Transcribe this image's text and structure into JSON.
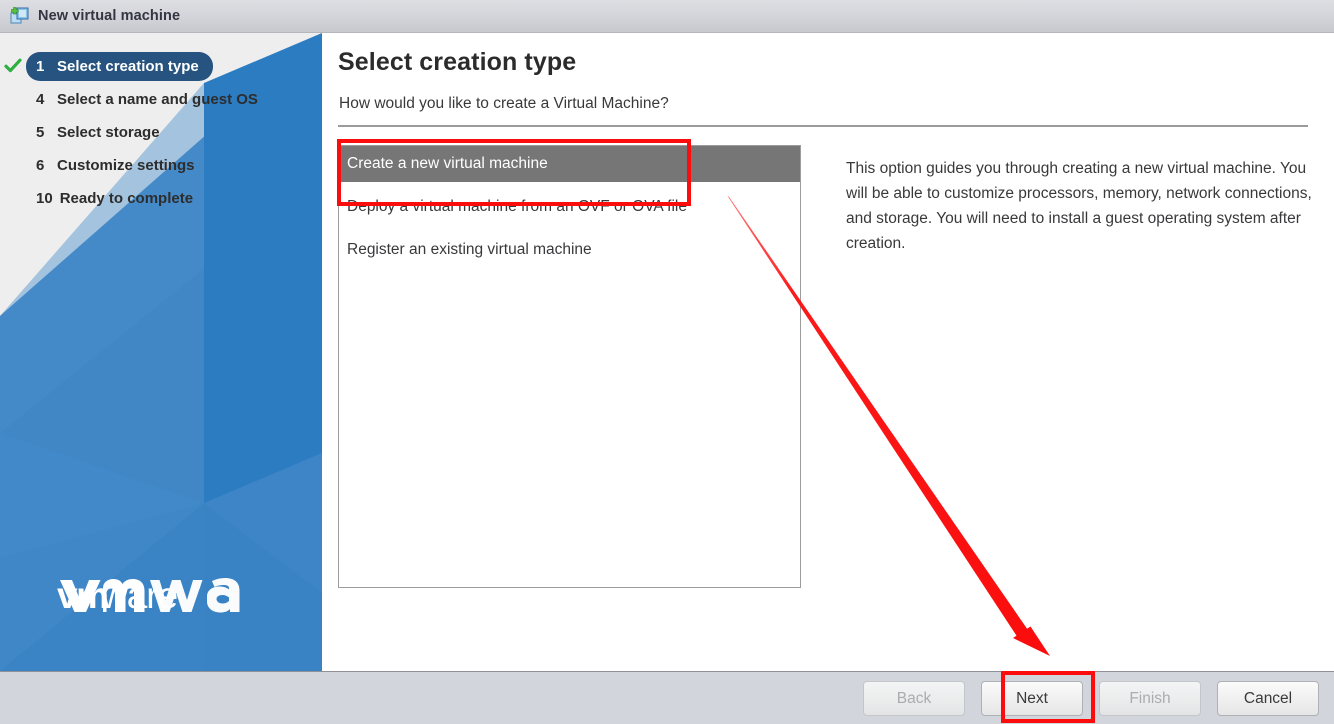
{
  "window": {
    "title": "New virtual machine",
    "icon": "new-vm-icon"
  },
  "sidebar": {
    "steps": [
      {
        "number": "1",
        "label": "Select creation type",
        "state": "completed-active",
        "check": true
      },
      {
        "number": "4",
        "label": "Select a name and guest OS",
        "state": "pending",
        "check": false
      },
      {
        "number": "5",
        "label": "Select storage",
        "state": "pending",
        "check": false
      },
      {
        "number": "6",
        "label": "Customize settings",
        "state": "pending",
        "check": false
      },
      {
        "number": "10",
        "label": "Ready to complete",
        "state": "pending",
        "check": false
      }
    ],
    "brand": "vmware",
    "brand_trademark": "®"
  },
  "main": {
    "title": "Select creation type",
    "subtitle": "How would you like to create a Virtual Machine?",
    "options": [
      {
        "label": "Create a new virtual machine",
        "selected": true
      },
      {
        "label": "Deploy a virtual machine from an OVF or OVA file",
        "selected": false
      },
      {
        "label": "Register an existing virtual machine",
        "selected": false
      }
    ],
    "description": "This option guides you through creating a new virtual machine. You will be able to customize processors, memory, network connections, and storage. You will need to install a guest operating system after creation."
  },
  "footer": {
    "buttons": [
      {
        "label": "Back",
        "enabled": false
      },
      {
        "label": "Next",
        "enabled": true
      },
      {
        "label": "Finish",
        "enabled": false
      },
      {
        "label": "Cancel",
        "enabled": true
      }
    ]
  },
  "annotations": {
    "highlight_color": "#fb0d0d",
    "rects": [
      {
        "name": "create-new-vm-option"
      },
      {
        "name": "next-button"
      }
    ],
    "arrow": {
      "from": "create-new-vm-option",
      "to": "next-button"
    }
  },
  "colors": {
    "accent_navy": "#26537f",
    "brand_blue": "#3b82c4",
    "selection_gray": "#767676",
    "check_green": "#39b54a",
    "annotation_red": "#fb0d0d"
  }
}
